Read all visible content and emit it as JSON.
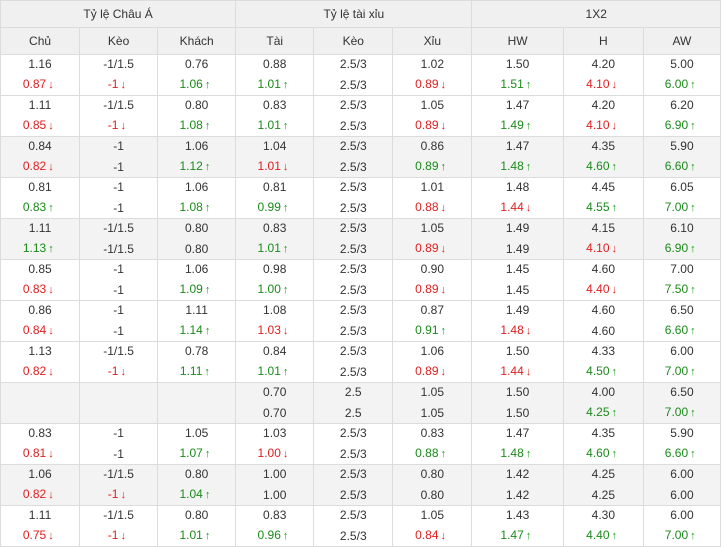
{
  "groups": [
    "Tỷ lệ Châu Á",
    "Tỷ lệ tài xỉu",
    "1X2"
  ],
  "columns": [
    "Chủ",
    "Kèo",
    "Khách",
    "Tài",
    "Kèo",
    "Xỉu",
    "HW",
    "H",
    "AW"
  ],
  "rows": [
    {
      "shade": false,
      "r1": [
        {
          "v": "1.16"
        },
        {
          "v": "-1/1.5"
        },
        {
          "v": "0.76"
        },
        {
          "v": "0.88"
        },
        {
          "v": "2.5/3"
        },
        {
          "v": "1.02"
        },
        {
          "v": "1.50"
        },
        {
          "v": "4.20"
        },
        {
          "v": "5.00"
        }
      ],
      "r2": [
        {
          "v": "0.87",
          "c": "red",
          "a": "down"
        },
        {
          "v": "-1",
          "c": "red",
          "a": "down"
        },
        {
          "v": "1.06",
          "c": "green",
          "a": "up"
        },
        {
          "v": "1.01",
          "c": "green",
          "a": "up"
        },
        {
          "v": "2.5/3"
        },
        {
          "v": "0.89",
          "c": "red",
          "a": "down"
        },
        {
          "v": "1.51",
          "c": "green",
          "a": "up"
        },
        {
          "v": "4.10",
          "c": "red",
          "a": "down"
        },
        {
          "v": "6.00",
          "c": "green",
          "a": "up"
        }
      ]
    },
    {
      "shade": false,
      "r1": [
        {
          "v": "1.11"
        },
        {
          "v": "-1/1.5"
        },
        {
          "v": "0.80"
        },
        {
          "v": "0.83"
        },
        {
          "v": "2.5/3"
        },
        {
          "v": "1.05"
        },
        {
          "v": "1.47"
        },
        {
          "v": "4.20"
        },
        {
          "v": "6.20"
        }
      ],
      "r2": [
        {
          "v": "0.85",
          "c": "red",
          "a": "down"
        },
        {
          "v": "-1",
          "c": "red",
          "a": "down"
        },
        {
          "v": "1.08",
          "c": "green",
          "a": "up"
        },
        {
          "v": "1.01",
          "c": "green",
          "a": "up"
        },
        {
          "v": "2.5/3"
        },
        {
          "v": "0.89",
          "c": "red",
          "a": "down"
        },
        {
          "v": "1.49",
          "c": "green",
          "a": "up"
        },
        {
          "v": "4.10",
          "c": "red",
          "a": "down"
        },
        {
          "v": "6.90",
          "c": "green",
          "a": "up"
        }
      ]
    },
    {
      "shade": true,
      "r1": [
        {
          "v": "0.84"
        },
        {
          "v": "-1"
        },
        {
          "v": "1.06"
        },
        {
          "v": "1.04"
        },
        {
          "v": "2.5/3"
        },
        {
          "v": "0.86"
        },
        {
          "v": "1.47"
        },
        {
          "v": "4.35"
        },
        {
          "v": "5.90"
        }
      ],
      "r2": [
        {
          "v": "0.82",
          "c": "red",
          "a": "down"
        },
        {
          "v": "-1"
        },
        {
          "v": "1.12",
          "c": "green",
          "a": "up"
        },
        {
          "v": "1.01",
          "c": "red",
          "a": "down"
        },
        {
          "v": "2.5/3"
        },
        {
          "v": "0.89",
          "c": "green",
          "a": "up"
        },
        {
          "v": "1.48",
          "c": "green",
          "a": "up"
        },
        {
          "v": "4.60",
          "c": "green",
          "a": "up"
        },
        {
          "v": "6.60",
          "c": "green",
          "a": "up"
        }
      ]
    },
    {
      "shade": false,
      "r1": [
        {
          "v": "0.81"
        },
        {
          "v": "-1"
        },
        {
          "v": "1.06"
        },
        {
          "v": "0.81"
        },
        {
          "v": "2.5/3"
        },
        {
          "v": "1.01"
        },
        {
          "v": "1.48"
        },
        {
          "v": "4.45"
        },
        {
          "v": "6.05"
        }
      ],
      "r2": [
        {
          "v": "0.83",
          "c": "green",
          "a": "up"
        },
        {
          "v": "-1"
        },
        {
          "v": "1.08",
          "c": "green",
          "a": "up"
        },
        {
          "v": "0.99",
          "c": "green",
          "a": "up"
        },
        {
          "v": "2.5/3"
        },
        {
          "v": "0.88",
          "c": "red",
          "a": "down"
        },
        {
          "v": "1.44",
          "c": "red",
          "a": "down"
        },
        {
          "v": "4.55",
          "c": "green",
          "a": "up"
        },
        {
          "v": "7.00",
          "c": "green",
          "a": "up"
        }
      ]
    },
    {
      "shade": true,
      "r1": [
        {
          "v": "1.11"
        },
        {
          "v": "-1/1.5"
        },
        {
          "v": "0.80"
        },
        {
          "v": "0.83"
        },
        {
          "v": "2.5/3"
        },
        {
          "v": "1.05"
        },
        {
          "v": "1.49"
        },
        {
          "v": "4.15"
        },
        {
          "v": "6.10"
        }
      ],
      "r2": [
        {
          "v": "1.13",
          "c": "green",
          "a": "up"
        },
        {
          "v": "-1/1.5"
        },
        {
          "v": "0.80"
        },
        {
          "v": "1.01",
          "c": "green",
          "a": "up"
        },
        {
          "v": "2.5/3"
        },
        {
          "v": "0.89",
          "c": "red",
          "a": "down"
        },
        {
          "v": "1.49"
        },
        {
          "v": "4.10",
          "c": "red",
          "a": "down"
        },
        {
          "v": "6.90",
          "c": "green",
          "a": "up"
        }
      ]
    },
    {
      "shade": false,
      "r1": [
        {
          "v": "0.85"
        },
        {
          "v": "-1"
        },
        {
          "v": "1.06"
        },
        {
          "v": "0.98"
        },
        {
          "v": "2.5/3"
        },
        {
          "v": "0.90"
        },
        {
          "v": "1.45"
        },
        {
          "v": "4.60"
        },
        {
          "v": "7.00"
        }
      ],
      "r2": [
        {
          "v": "0.83",
          "c": "red",
          "a": "down"
        },
        {
          "v": "-1"
        },
        {
          "v": "1.09",
          "c": "green",
          "a": "up"
        },
        {
          "v": "1.00",
          "c": "green",
          "a": "up"
        },
        {
          "v": "2.5/3"
        },
        {
          "v": "0.89",
          "c": "red",
          "a": "down"
        },
        {
          "v": "1.45"
        },
        {
          "v": "4.40",
          "c": "red",
          "a": "down"
        },
        {
          "v": "7.50",
          "c": "green",
          "a": "up"
        }
      ]
    },
    {
      "shade": false,
      "r1": [
        {
          "v": "0.86"
        },
        {
          "v": "-1"
        },
        {
          "v": "1.11"
        },
        {
          "v": "1.08"
        },
        {
          "v": "2.5/3"
        },
        {
          "v": "0.87"
        },
        {
          "v": "1.49"
        },
        {
          "v": "4.60"
        },
        {
          "v": "6.50"
        }
      ],
      "r2": [
        {
          "v": "0.84",
          "c": "red",
          "a": "down"
        },
        {
          "v": "-1"
        },
        {
          "v": "1.14",
          "c": "green",
          "a": "up"
        },
        {
          "v": "1.03",
          "c": "red",
          "a": "down"
        },
        {
          "v": "2.5/3"
        },
        {
          "v": "0.91",
          "c": "green",
          "a": "up"
        },
        {
          "v": "1.48",
          "c": "red",
          "a": "down"
        },
        {
          "v": "4.60"
        },
        {
          "v": "6.60",
          "c": "green",
          "a": "up"
        }
      ]
    },
    {
      "shade": false,
      "r1": [
        {
          "v": "1.13"
        },
        {
          "v": "-1/1.5"
        },
        {
          "v": "0.78"
        },
        {
          "v": "0.84"
        },
        {
          "v": "2.5/3"
        },
        {
          "v": "1.06"
        },
        {
          "v": "1.50"
        },
        {
          "v": "4.33"
        },
        {
          "v": "6.00"
        }
      ],
      "r2": [
        {
          "v": "0.82",
          "c": "red",
          "a": "down"
        },
        {
          "v": "-1",
          "c": "red",
          "a": "down"
        },
        {
          "v": "1.11",
          "c": "green",
          "a": "up"
        },
        {
          "v": "1.01",
          "c": "green",
          "a": "up"
        },
        {
          "v": "2.5/3"
        },
        {
          "v": "0.89",
          "c": "red",
          "a": "down"
        },
        {
          "v": "1.44",
          "c": "red",
          "a": "down"
        },
        {
          "v": "4.50",
          "c": "green",
          "a": "up"
        },
        {
          "v": "7.00",
          "c": "green",
          "a": "up"
        }
      ]
    },
    {
      "shade": true,
      "r1": [
        {
          "v": ""
        },
        {
          "v": ""
        },
        {
          "v": ""
        },
        {
          "v": "0.70"
        },
        {
          "v": "2.5"
        },
        {
          "v": "1.05"
        },
        {
          "v": "1.50"
        },
        {
          "v": "4.00"
        },
        {
          "v": "6.50"
        }
      ],
      "r2": [
        {
          "v": ""
        },
        {
          "v": ""
        },
        {
          "v": ""
        },
        {
          "v": "0.70"
        },
        {
          "v": "2.5"
        },
        {
          "v": "1.05"
        },
        {
          "v": "1.50"
        },
        {
          "v": "4.25",
          "c": "green",
          "a": "up"
        },
        {
          "v": "7.00",
          "c": "green",
          "a": "up"
        }
      ]
    },
    {
      "shade": false,
      "r1": [
        {
          "v": "0.83"
        },
        {
          "v": "-1"
        },
        {
          "v": "1.05"
        },
        {
          "v": "1.03"
        },
        {
          "v": "2.5/3"
        },
        {
          "v": "0.83"
        },
        {
          "v": "1.47"
        },
        {
          "v": "4.35"
        },
        {
          "v": "5.90"
        }
      ],
      "r2": [
        {
          "v": "0.81",
          "c": "red",
          "a": "down"
        },
        {
          "v": "-1"
        },
        {
          "v": "1.07",
          "c": "green",
          "a": "up"
        },
        {
          "v": "1.00",
          "c": "red",
          "a": "down"
        },
        {
          "v": "2.5/3"
        },
        {
          "v": "0.88",
          "c": "green",
          "a": "up"
        },
        {
          "v": "1.48",
          "c": "green",
          "a": "up"
        },
        {
          "v": "4.60",
          "c": "green",
          "a": "up"
        },
        {
          "v": "6.60",
          "c": "green",
          "a": "up"
        }
      ]
    },
    {
      "shade": true,
      "r1": [
        {
          "v": "1.06"
        },
        {
          "v": "-1/1.5"
        },
        {
          "v": "0.80"
        },
        {
          "v": "1.00"
        },
        {
          "v": "2.5/3"
        },
        {
          "v": "0.80"
        },
        {
          "v": "1.42"
        },
        {
          "v": "4.25"
        },
        {
          "v": "6.00"
        }
      ],
      "r2": [
        {
          "v": "0.82",
          "c": "red",
          "a": "down"
        },
        {
          "v": "-1",
          "c": "red",
          "a": "down"
        },
        {
          "v": "1.04",
          "c": "green",
          "a": "up"
        },
        {
          "v": "1.00"
        },
        {
          "v": "2.5/3"
        },
        {
          "v": "0.80"
        },
        {
          "v": "1.42"
        },
        {
          "v": "4.25"
        },
        {
          "v": "6.00"
        }
      ]
    },
    {
      "shade": false,
      "r1": [
        {
          "v": "1.11"
        },
        {
          "v": "-1/1.5"
        },
        {
          "v": "0.80"
        },
        {
          "v": "0.83"
        },
        {
          "v": "2.5/3"
        },
        {
          "v": "1.05"
        },
        {
          "v": "1.43"
        },
        {
          "v": "4.30"
        },
        {
          "v": "6.00"
        }
      ],
      "r2": [
        {
          "v": "0.75",
          "c": "red",
          "a": "down"
        },
        {
          "v": "-1",
          "c": "red",
          "a": "down"
        },
        {
          "v": "1.01",
          "c": "green",
          "a": "up"
        },
        {
          "v": "0.96",
          "c": "green",
          "a": "up"
        },
        {
          "v": "2.5/3"
        },
        {
          "v": "0.84",
          "c": "red",
          "a": "down"
        },
        {
          "v": "1.47",
          "c": "green",
          "a": "up"
        },
        {
          "v": "4.40",
          "c": "green",
          "a": "up"
        },
        {
          "v": "7.00",
          "c": "green",
          "a": "up"
        }
      ]
    }
  ]
}
